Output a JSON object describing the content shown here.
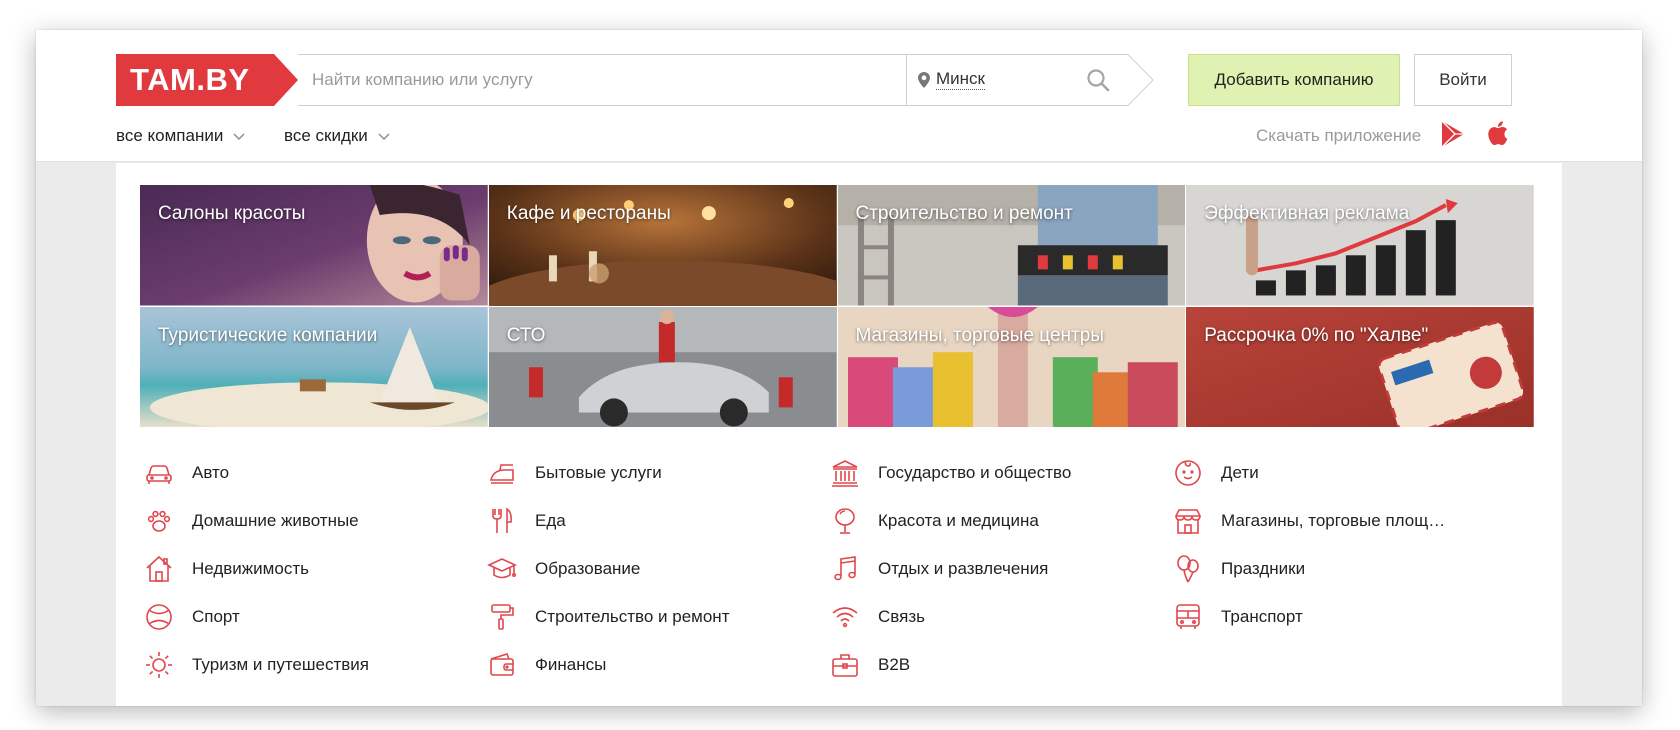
{
  "header": {
    "logo_text": "TAM.BY",
    "search_placeholder": "Найти компанию или услугу",
    "city": "Минск",
    "add_company": "Добавить компанию",
    "login": "Войти",
    "nav": [
      "все компании",
      "все скидки"
    ],
    "download_app": "Скачать приложение",
    "icons": [
      "map-pin-icon",
      "search-icon",
      "google-play-icon",
      "apple-icon",
      "chevron-down-icon"
    ]
  },
  "tiles": [
    {
      "label": "Салоны красоты"
    },
    {
      "label": "Кафе и рестораны"
    },
    {
      "label": "Строительство и ремонт"
    },
    {
      "label": "Эффективная реклама"
    },
    {
      "label": "Туристические компании"
    },
    {
      "label": "СТО"
    },
    {
      "label": "Магазины, торговые центры"
    },
    {
      "label": "Рассрочка 0% по \"Халве\""
    }
  ],
  "categories": [
    {
      "label": "Авто",
      "icon": "car-icon"
    },
    {
      "label": "Домашние животные",
      "icon": "paw-icon"
    },
    {
      "label": "Недвижимость",
      "icon": "house-icon"
    },
    {
      "label": "Спорт",
      "icon": "ball-icon"
    },
    {
      "label": "Туризм и путешествия",
      "icon": "sun-icon"
    },
    {
      "label": "Бытовые услуги",
      "icon": "iron-icon"
    },
    {
      "label": "Еда",
      "icon": "fork-knife-icon"
    },
    {
      "label": "Образование",
      "icon": "graduation-cap-icon"
    },
    {
      "label": "Строительство и ремонт",
      "icon": "paint-roller-icon"
    },
    {
      "label": "Финансы",
      "icon": "wallet-icon"
    },
    {
      "label": "Государство и общество",
      "icon": "government-building-icon"
    },
    {
      "label": "Красота и медицина",
      "icon": "mirror-icon"
    },
    {
      "label": "Отдых и развлечения",
      "icon": "music-note-icon"
    },
    {
      "label": "Связь",
      "icon": "wifi-icon"
    },
    {
      "label": "B2B",
      "icon": "briefcase-icon"
    },
    {
      "label": "Дети",
      "icon": "child-face-icon"
    },
    {
      "label": "Магазины, торговые площ…",
      "icon": "store-icon"
    },
    {
      "label": "Праздники",
      "icon": "balloons-icon"
    },
    {
      "label": "Транспорт",
      "icon": "bus-icon"
    }
  ],
  "colors": {
    "brand_red": "#e03a3e",
    "add_button_bg": "#dff2b1",
    "icon_red": "#e0474c"
  }
}
